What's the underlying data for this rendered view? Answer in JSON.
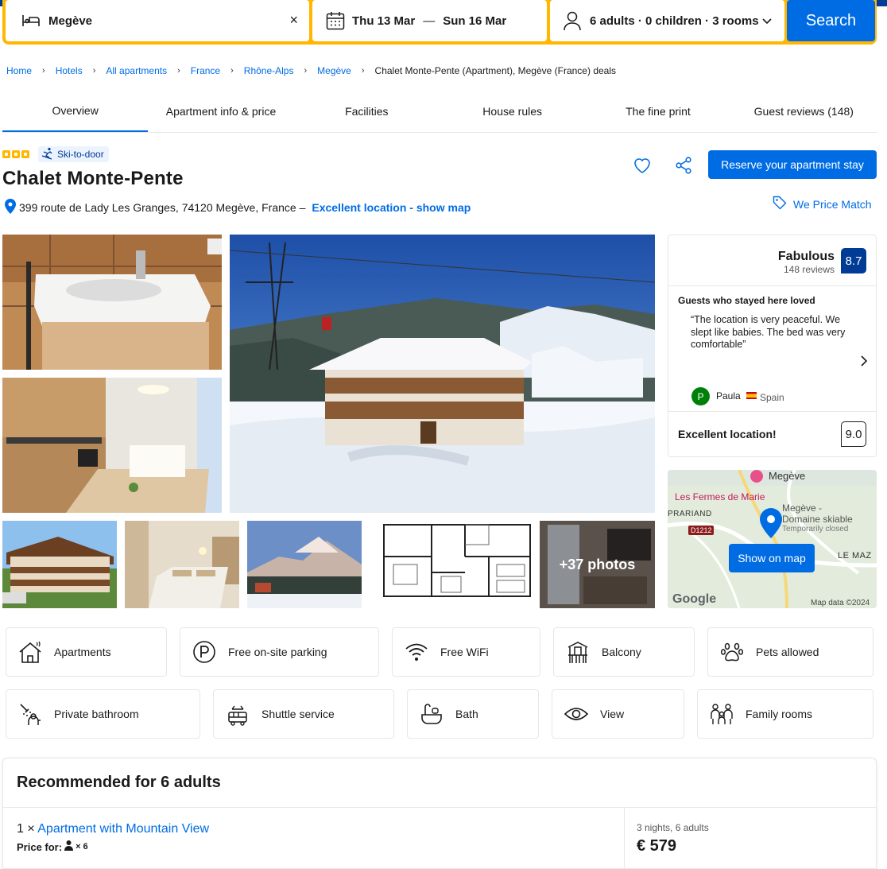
{
  "search": {
    "destination": "Megève",
    "check_in": "Thu 13 Mar",
    "date_separator": "—",
    "check_out": "Sun 16 Mar",
    "guests": "6 adults · 0 children · 3 rooms",
    "button": "Search"
  },
  "breadcrumb": [
    "Home",
    "Hotels",
    "All apartments",
    "France",
    "Rhône-Alps",
    "Megève"
  ],
  "breadcrumb_current": "Chalet Monte-Pente (Apartment), Megève (France) deals",
  "tabs": [
    "Overview",
    "Apartment info & price",
    "Facilities",
    "House rules",
    "The fine print",
    "Guest reviews (148)"
  ],
  "property": {
    "star_count": 3,
    "badge": "Ski-to-door",
    "name": "Chalet Monte-Pente",
    "address": "399 route de Lady Les Granges, 74120 Megève, France –",
    "location_link": "Excellent location - show map",
    "reserve_button": "Reserve your apartment stay",
    "price_match": "We Price Match"
  },
  "gallery": {
    "more_photos": "+37 photos"
  },
  "review": {
    "word": "Fabulous",
    "count": "148 reviews",
    "score": "8.7",
    "loved_heading": "Guests who stayed here loved",
    "quote": "“The location is very peaceful. We slept like babies. The bed was very comfortable”",
    "reviewer_initial": "P",
    "reviewer_name": "Paula",
    "reviewer_country": "Spain",
    "location_label": "Excellent location!",
    "location_score": "9.0"
  },
  "map": {
    "labels": {
      "town": "Megève",
      "fermes": "Les Fermes de Marie",
      "prariand": "PRARIAND",
      "road": "D1212",
      "domaine": "Megève -",
      "domaine2": "Domaine skiable",
      "closed": "Temporarily closed",
      "lemaz": "LE MAZ",
      "google": "Google",
      "mapdata": "Map data ©2024"
    },
    "button": "Show on map"
  },
  "facilities": [
    {
      "label": "Apartments",
      "icon": "house-icon"
    },
    {
      "label": "Free on-site parking",
      "icon": "parking-icon"
    },
    {
      "label": "Free WiFi",
      "icon": "wifi-icon"
    },
    {
      "label": "Balcony",
      "icon": "balcony-icon"
    },
    {
      "label": "Pets allowed",
      "icon": "paw-icon"
    },
    {
      "label": "Private bathroom",
      "icon": "shower-icon"
    },
    {
      "label": "Shuttle service",
      "icon": "shuttle-icon"
    },
    {
      "label": "Bath",
      "icon": "bathtub-icon"
    },
    {
      "label": "View",
      "icon": "eye-icon"
    },
    {
      "label": "Family rooms",
      "icon": "family-icon"
    }
  ],
  "recommended": {
    "title": "Recommended for 6 adults",
    "room_prefix": "1 ×",
    "room_link": "Apartment with Mountain View",
    "price_for_label": "Price for:",
    "price_for_count": "× 6",
    "nights": "3 nights, 6 adults",
    "price": "€ 579"
  },
  "colors": {
    "brand_blue": "#006ce4",
    "dark_blue": "#003b95",
    "yellow": "#ffb700",
    "green": "#008009"
  }
}
